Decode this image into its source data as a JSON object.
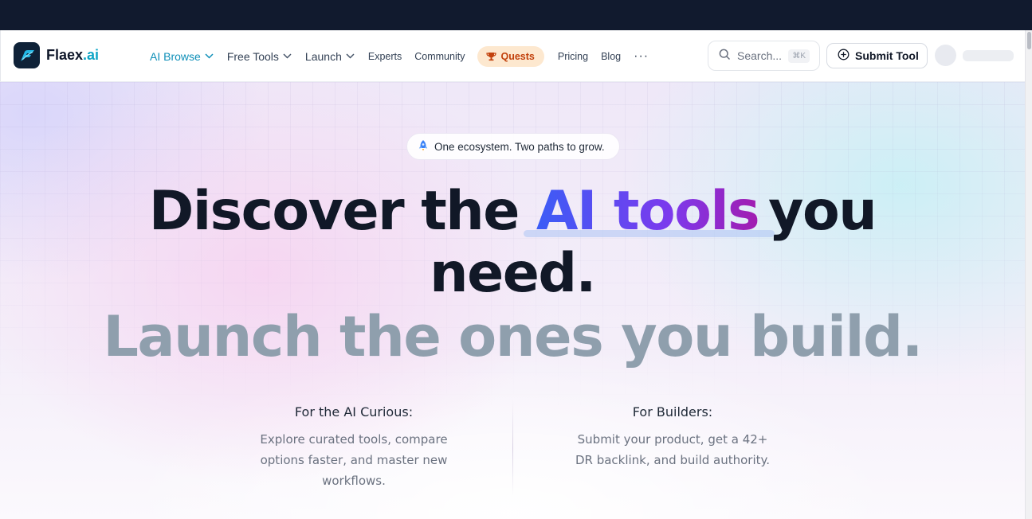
{
  "brand": {
    "name": "Flaex",
    "suffix": ".ai"
  },
  "nav": {
    "ai_browse": "AI Browse",
    "free_tools": "Free Tools",
    "launch": "Launch",
    "experts": "Experts",
    "community": "Community",
    "quests": "Quests",
    "pricing": "Pricing",
    "blog": "Blog",
    "more": "···"
  },
  "search": {
    "placeholder": "Search...",
    "shortcut": "⌘K"
  },
  "submit_tool": "Submit Tool",
  "hero": {
    "badge": "One ecosystem. Two paths to grow.",
    "headline_part1": "Discover the",
    "headline_accent": "AI tools",
    "headline_part2": "you",
    "headline_part3": "need.",
    "subheadline": "Launch the ones you build."
  },
  "audiences": {
    "curious": {
      "title": "For the AI Curious:",
      "body": "Explore curated tools, compare options faster, and master new workflows."
    },
    "builders": {
      "title": "For Builders:",
      "body": "Submit your product, get a 42+ DR backlink, and build authority."
    }
  },
  "colors": {
    "topbar": "#111a2e",
    "accent_start": "#3b5cf6",
    "accent_end": "#a21caf",
    "brand_ai": "#0ea5c6",
    "active_nav": "#0e8fb8",
    "quests_bg": "#fde8cf",
    "quests_text": "#c2410c"
  }
}
